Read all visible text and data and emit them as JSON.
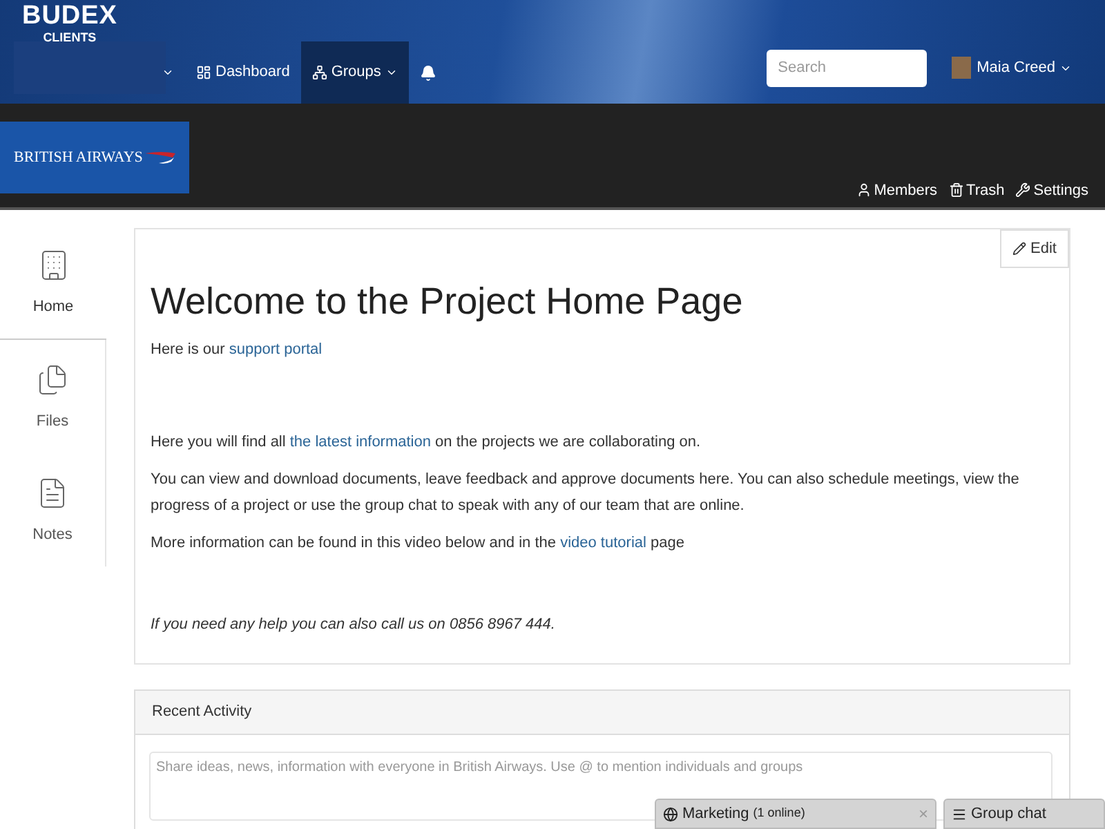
{
  "brand": {
    "name": "BUDEX",
    "sub": "CLIENTS"
  },
  "nav": [
    {
      "label": "Dashboard",
      "selected": false
    },
    {
      "label": "Groups",
      "selected": true
    }
  ],
  "search": {
    "placeholder": "Search"
  },
  "user": {
    "name": "Maia Creed"
  },
  "org": {
    "name": "BRITISH AIRWAYS"
  },
  "toolbar": [
    {
      "label": "Members"
    },
    {
      "label": "Trash"
    },
    {
      "label": "Settings"
    }
  ],
  "sidebar": [
    {
      "label": "Home",
      "selected": true
    },
    {
      "label": "Files",
      "selected": false
    },
    {
      "label": "Notes",
      "selected": false
    }
  ],
  "page": {
    "edit": "Edit",
    "title": "Welcome to the Project Home Page",
    "paragraphs": [
      [
        {
          "kind": "text",
          "text": "Here is our "
        },
        {
          "kind": "link",
          "text": "support portal"
        }
      ],
      [
        {
          "kind": "text",
          "text": "Here you will find all "
        },
        {
          "kind": "link",
          "text": "the latest information"
        },
        {
          "kind": "text",
          "text": " on the projects we are collaborating on."
        }
      ],
      [
        {
          "kind": "text",
          "text": "You can view and download documents, leave feedback and approve documents here. You can also schedule meetings, view the progress of a project or use the group chat to speak with any of our team that are online."
        }
      ],
      [
        {
          "kind": "text",
          "text": "More information can be found in this video below and in the "
        },
        {
          "kind": "link",
          "text": "video tutorial"
        },
        {
          "kind": "text",
          "text": " page"
        }
      ],
      [
        {
          "kind": "italic",
          "text": "If you need any help you can also call us on 0856 8967 444."
        }
      ]
    ]
  },
  "activity": {
    "title": "Recent Activity",
    "placeholder": "Share ideas, news, information with everyone in British Airways. Use @ to mention individuals and groups"
  },
  "chats": [
    {
      "kind": "group",
      "name": "Marketing",
      "count": "(1 online)",
      "close": "×"
    },
    {
      "kind": "list",
      "name": "Group chat"
    }
  ]
}
